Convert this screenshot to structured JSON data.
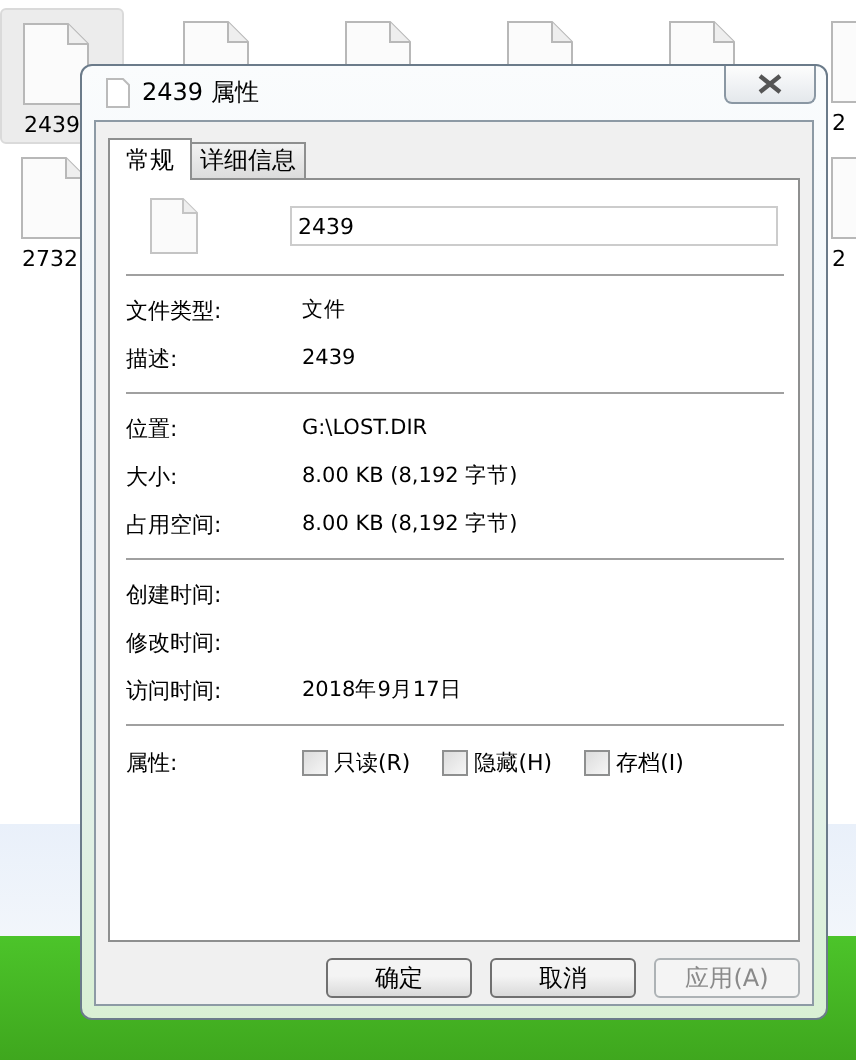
{
  "desktop": {
    "rows": [
      [
        {
          "kind": "file",
          "label": "2439",
          "selected": true
        },
        {
          "kind": "file",
          "selected": false
        },
        {
          "kind": "file",
          "selected": false
        },
        {
          "kind": "file",
          "selected": false
        },
        {
          "kind": "file",
          "selected": false
        },
        {
          "kind": "file",
          "label": "2",
          "selected": false
        }
      ],
      [
        {
          "kind": "file",
          "label": "2732",
          "selected": false
        },
        {
          "kind": "empty"
        },
        {
          "kind": "empty"
        },
        {
          "kind": "empty"
        },
        {
          "kind": "empty"
        },
        {
          "kind": "file",
          "label": "2",
          "selected": false
        }
      ]
    ]
  },
  "window": {
    "title": "2439 属性"
  },
  "tabs": [
    {
      "label": "常规",
      "selected": true
    },
    {
      "label": "详细信息",
      "selected": false
    }
  ],
  "name_field": {
    "value": "2439"
  },
  "groups": [
    [
      {
        "label": "文件类型:",
        "value": "文件"
      },
      {
        "label": "描述:",
        "value": "2439"
      }
    ],
    [
      {
        "label": "位置:",
        "value": "G:\\LOST.DIR"
      },
      {
        "label": "大小:",
        "value": "8.00 KB (8,192 字节)"
      },
      {
        "label": "占用空间:",
        "value": "8.00 KB (8,192 字节)"
      }
    ],
    [
      {
        "label": "创建时间:"
      },
      {
        "label": "修改时间:"
      },
      {
        "label": "访问时间:",
        "value": "2018年9月17日"
      }
    ]
  ],
  "attributes": {
    "label": "属性:",
    "options": [
      {
        "label": "只读(R)",
        "checked": false
      },
      {
        "label": "隐藏(H)",
        "checked": false
      },
      {
        "label": "存档(I)",
        "checked": false
      }
    ]
  },
  "buttons": [
    {
      "label": "确定",
      "disabled": false
    },
    {
      "label": "取消",
      "disabled": false
    },
    {
      "label": "应用(A)",
      "disabled": true
    }
  ]
}
